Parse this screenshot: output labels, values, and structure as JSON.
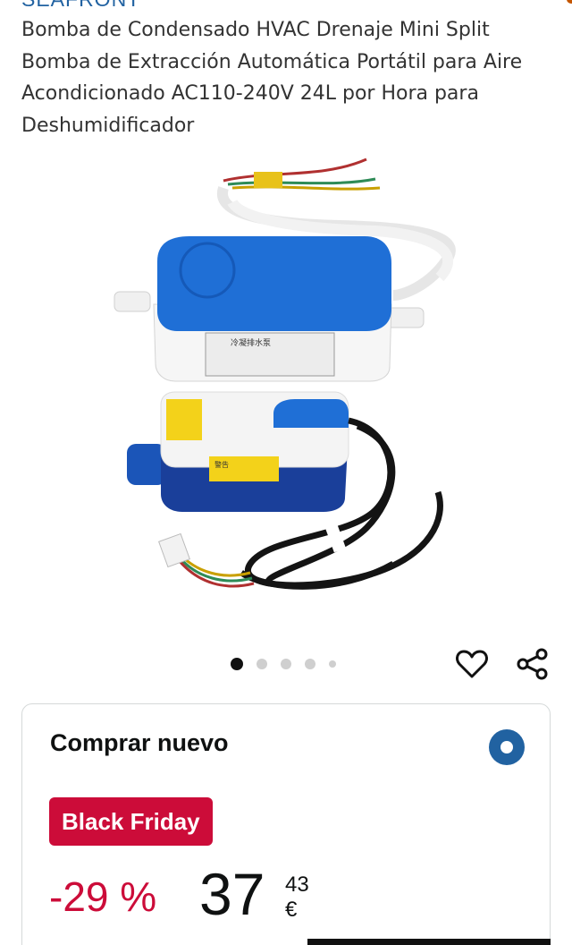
{
  "brand": "SEAFRONT",
  "product": {
    "title": "Bomba de Condensado HVAC Drenaje Mini Split Bomba de Extracción Automática Portátil para Aire Acondicionado AC110-240V 24L por Hora para Deshumidificador",
    "image_icon": "condensate-pump-product-photo",
    "image_label_top": "冷凝排水泵",
    "image_label_warning": "警告"
  },
  "carousel": {
    "total": 5,
    "active_index": 0
  },
  "actions": {
    "wishlist_icon": "heart-icon",
    "share_icon": "share-icon"
  },
  "buy_box": {
    "heading": "Comprar nuevo",
    "deal_badge": "Black Friday",
    "discount": "-29 %",
    "price_whole": "37",
    "price_fraction": "43 €",
    "accent_color": "#2162a1",
    "deal_color": "#cc0c39"
  }
}
